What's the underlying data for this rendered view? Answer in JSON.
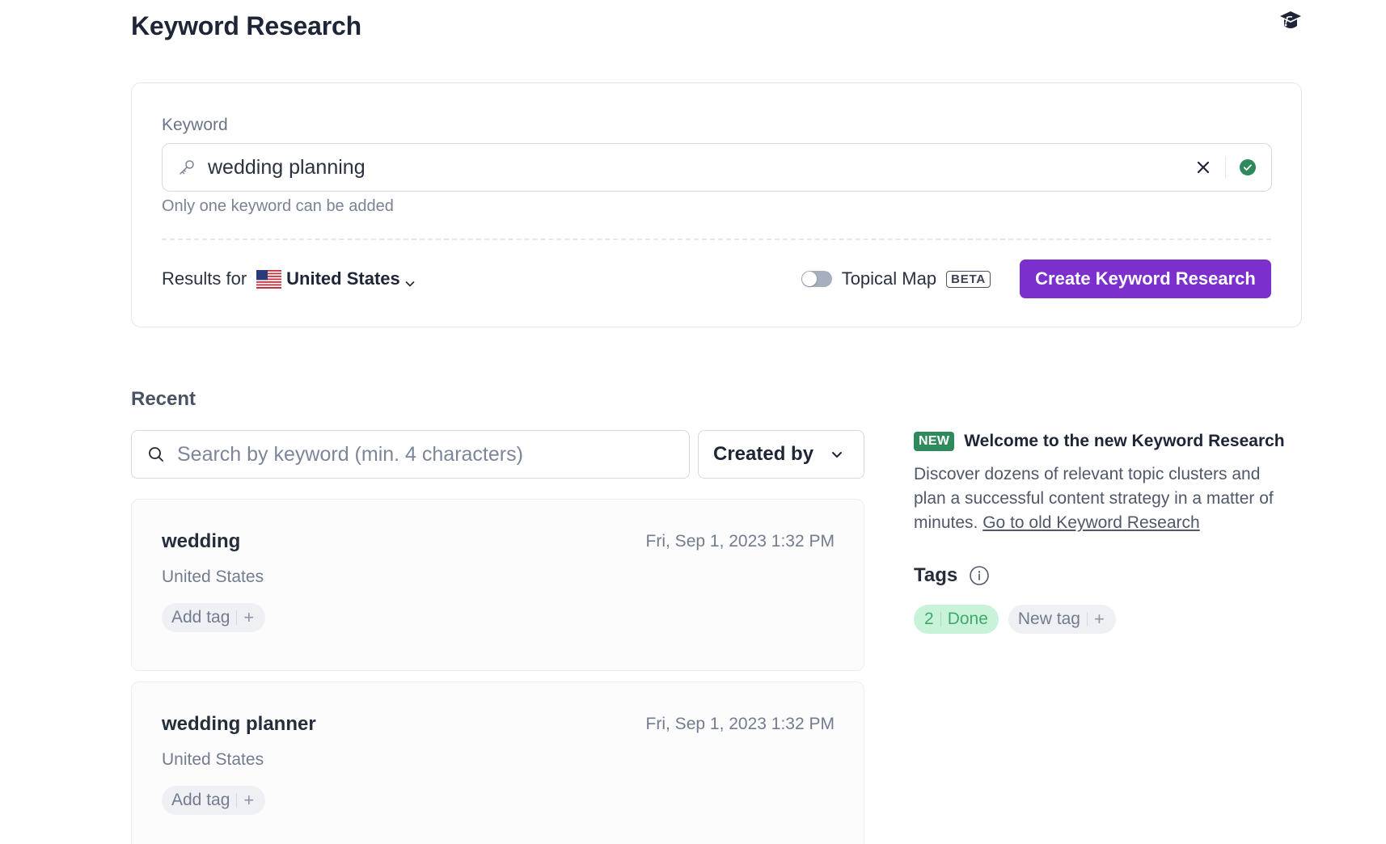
{
  "header": {
    "title": "Keyword Research",
    "academy_icon": "graduation-cap-icon"
  },
  "keyword_form": {
    "label": "Keyword",
    "value": "wedding planning",
    "helper": "Only one keyword can be added",
    "results_for_label": "Results for",
    "country": "United States",
    "topical_map_label": "Topical Map",
    "topical_map_enabled": false,
    "beta_badge": "BETA",
    "create_button": "Create Keyword Research",
    "accent_color": "#7b2fcc"
  },
  "recent": {
    "title": "Recent",
    "search_placeholder": "Search by keyword (min. 4 characters)",
    "search_value": "",
    "created_by_label": "Created by",
    "items": [
      {
        "keyword": "wedding",
        "date": "Fri, Sep 1, 2023 1:32 PM",
        "location": "United States",
        "add_tag": "Add tag"
      },
      {
        "keyword": "wedding planner",
        "date": "Fri, Sep 1, 2023 1:32 PM",
        "location": "United States",
        "add_tag": "Add tag"
      }
    ]
  },
  "side": {
    "new_badge": "NEW",
    "title": "Welcome to the new Keyword Research",
    "description": "Discover dozens of relevant topic clusters and plan a successful content strategy in a matter of minutes.",
    "old_link": "Go to old Keyword Research",
    "tags_title": "Tags",
    "tags": [
      {
        "count": "2",
        "label": "Done",
        "color": "#3ea86d"
      }
    ],
    "new_tag_label": "New tag"
  }
}
